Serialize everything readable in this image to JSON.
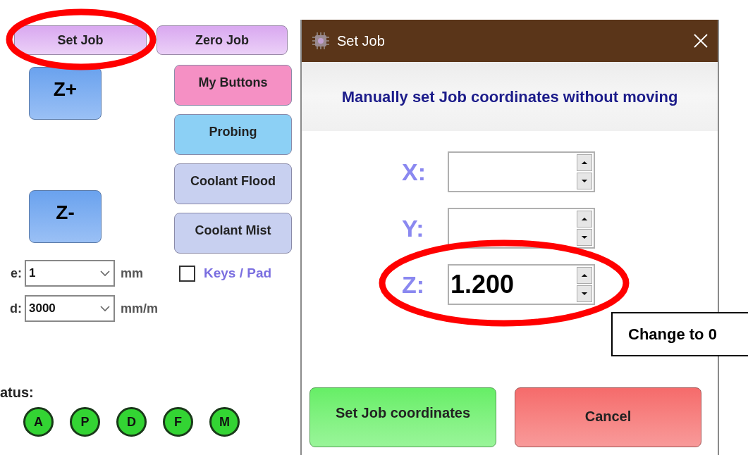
{
  "left_panel": {
    "top_buttons": [
      {
        "label": "Set Job",
        "highlighted": true
      },
      {
        "label": "Zero Job",
        "highlighted": false
      }
    ],
    "jog_buttons": [
      {
        "label": "Z+"
      },
      {
        "label": "Z-"
      }
    ],
    "side_buttons": [
      {
        "label": "My Buttons",
        "color": "#f590c4"
      },
      {
        "label": "Probing",
        "color": "#8cd0f5"
      },
      {
        "label": "Coolant Flood",
        "color": "#c8d0f0"
      },
      {
        "label": "Coolant Mist",
        "color": "#c8d0f0"
      }
    ],
    "step": {
      "label": "e:",
      "value": "1",
      "unit": "mm"
    },
    "feed": {
      "label": "d:",
      "value": "3000",
      "unit": "mm/m"
    },
    "keys_pad": {
      "label": "Keys / Pad",
      "checked": false
    },
    "status_label": "atus:",
    "indicators": [
      {
        "label": "A",
        "on": true
      },
      {
        "label": "P",
        "on": true
      },
      {
        "label": "D",
        "on": true
      },
      {
        "label": "F",
        "on": true
      },
      {
        "label": "M",
        "on": true
      }
    ]
  },
  "dialog": {
    "title": "Set Job",
    "heading": "Manually set Job coordinates without moving",
    "fields": [
      {
        "label": "X:",
        "highlighted": false
      },
      {
        "label": "Y:",
        "highlighted": false
      },
      {
        "label": "Z:",
        "value": "1.200",
        "highlighted": true
      }
    ],
    "buttons": [
      {
        "label": "Set Job coordinates",
        "kind": "confirm"
      },
      {
        "label": "Cancel",
        "kind": "cancel"
      }
    ]
  },
  "callout": "Change to 0"
}
